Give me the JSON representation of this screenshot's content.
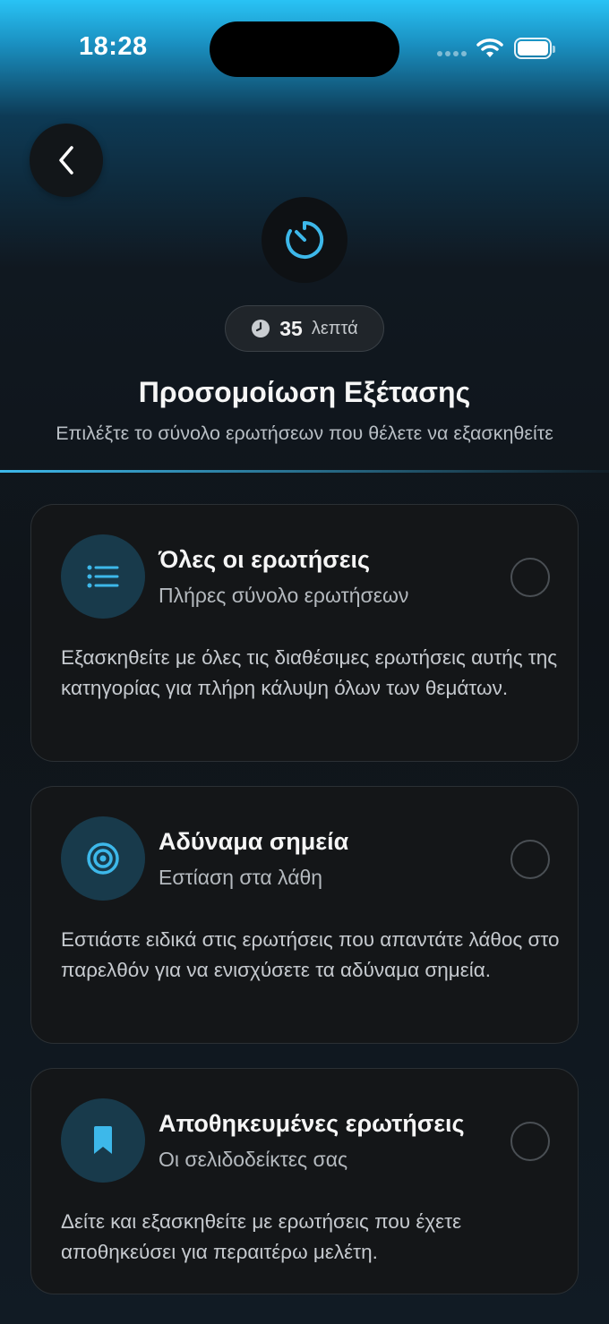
{
  "status_bar": {
    "time": "18:28"
  },
  "header": {
    "duration_value": "35",
    "duration_unit": "λεπτά",
    "title": "Προσομοίωση Εξέτασης",
    "subtitle": "Επιλέξτε το σύνολο ερωτήσεων που θέλετε να εξασκηθείτε"
  },
  "options": [
    {
      "title": "Όλες οι ερωτήσεις",
      "subtitle": "Πλήρες σύνολο ερωτήσεων",
      "description": "Εξασκηθείτε με όλες τις διαθέσιμες ερωτήσεις αυτής της κατηγορίας για πλήρη κάλυψη όλων των θεμάτων.",
      "icon": "list-icon",
      "selected": false
    },
    {
      "title": "Αδύναμα σημεία",
      "subtitle": "Εστίαση στα λάθη",
      "description": "Εστιάστε ειδικά στις ερωτήσεις που απαντάτε λάθος στο παρελθόν για να ενισχύσετε τα αδύναμα σημεία.",
      "icon": "target-icon",
      "selected": false
    },
    {
      "title": "Αποθηκευμένες ερωτήσεις",
      "subtitle": "Οι σελιδοδείκτες σας",
      "description": "Δείτε και εξασκηθείτε με ερωτήσεις που έχετε αποθηκεύσει για περαιτέρω μελέτη.",
      "icon": "bookmark-icon",
      "selected": false
    }
  ],
  "colors": {
    "accent": "#3db8ea",
    "card_background": "#141618",
    "icon_circle": "#183a4b"
  }
}
